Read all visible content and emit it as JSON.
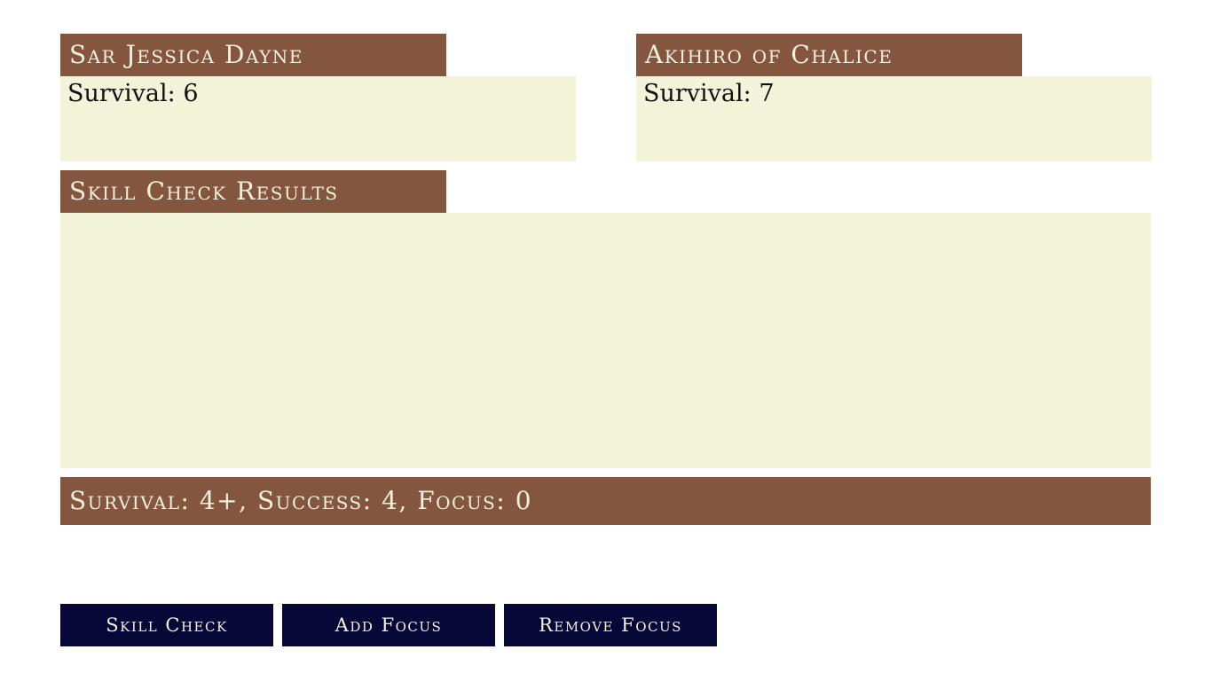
{
  "characters": [
    {
      "name": "Sar Jessica Dayne",
      "survival_text": "Survival: 6"
    },
    {
      "name": "Akihiro of Chalice",
      "survival_text": "Survival: 7"
    }
  ],
  "results": {
    "title": "Skill Check Results",
    "status": "Survival: 4+, Success: 4, Focus: 0"
  },
  "buttons": {
    "skill_check": "Skill Check",
    "add_focus": "Add Focus",
    "remove_focus": "Remove Focus"
  },
  "colors": {
    "header_brown": "#85563f",
    "panel_cream": "#f3f3da",
    "button_navy": "#060736",
    "header_text": "#f3f0dc"
  }
}
